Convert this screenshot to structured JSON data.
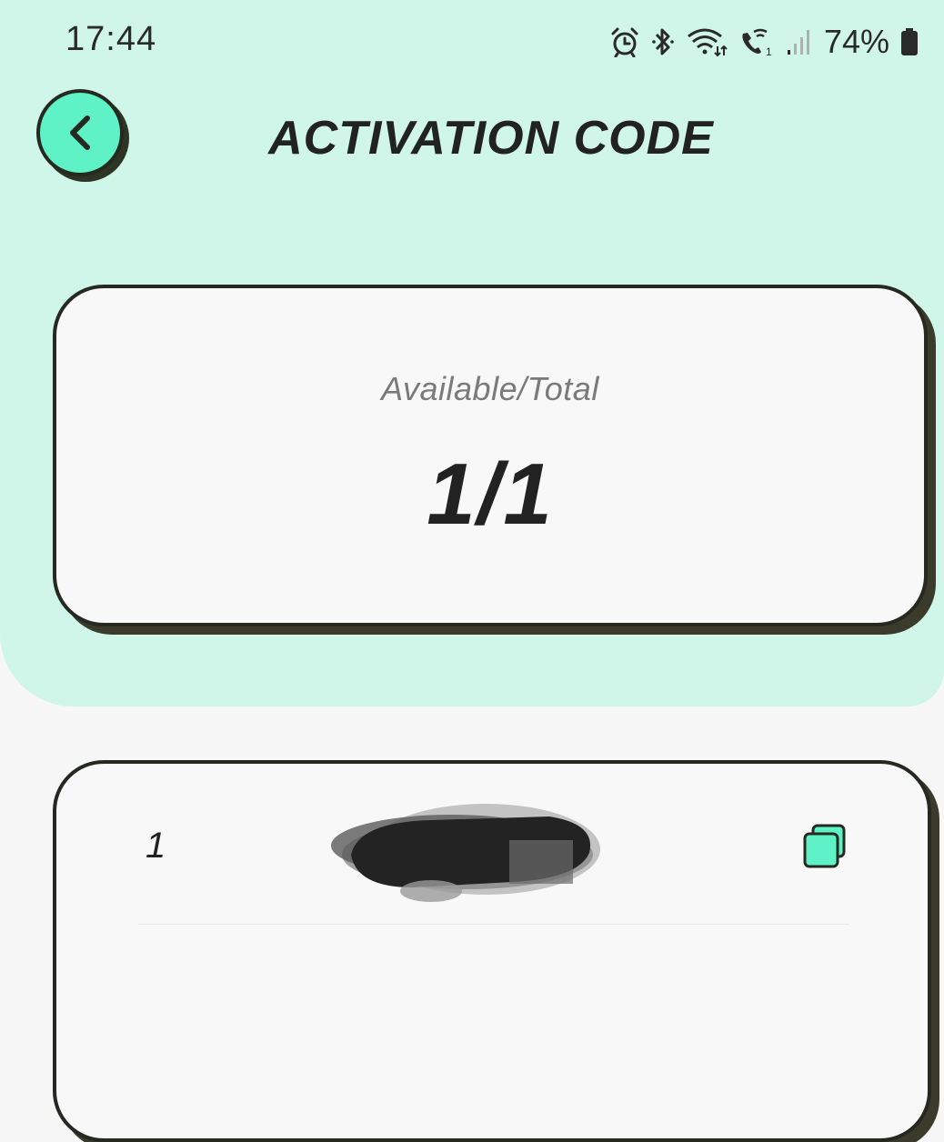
{
  "status_bar": {
    "time": "17:44",
    "battery": "74%",
    "icons": [
      "alarm-icon",
      "bluetooth-icon",
      "wifi-icon",
      "wifi-calling-icon",
      "signal-icon",
      "battery-icon"
    ]
  },
  "header": {
    "title": "ACTIVATION CODE",
    "back_icon": "chevron-left-icon"
  },
  "summary": {
    "label": "Available/Total",
    "value": "1/1"
  },
  "codes": {
    "rows": [
      {
        "index": "1",
        "copy_icon": "copy-icon"
      }
    ]
  },
  "colors": {
    "header_background": "#d0f6ea",
    "accent": "#5ef2c6",
    "page_background": "#f7f7f7",
    "outline": "#25291f"
  }
}
